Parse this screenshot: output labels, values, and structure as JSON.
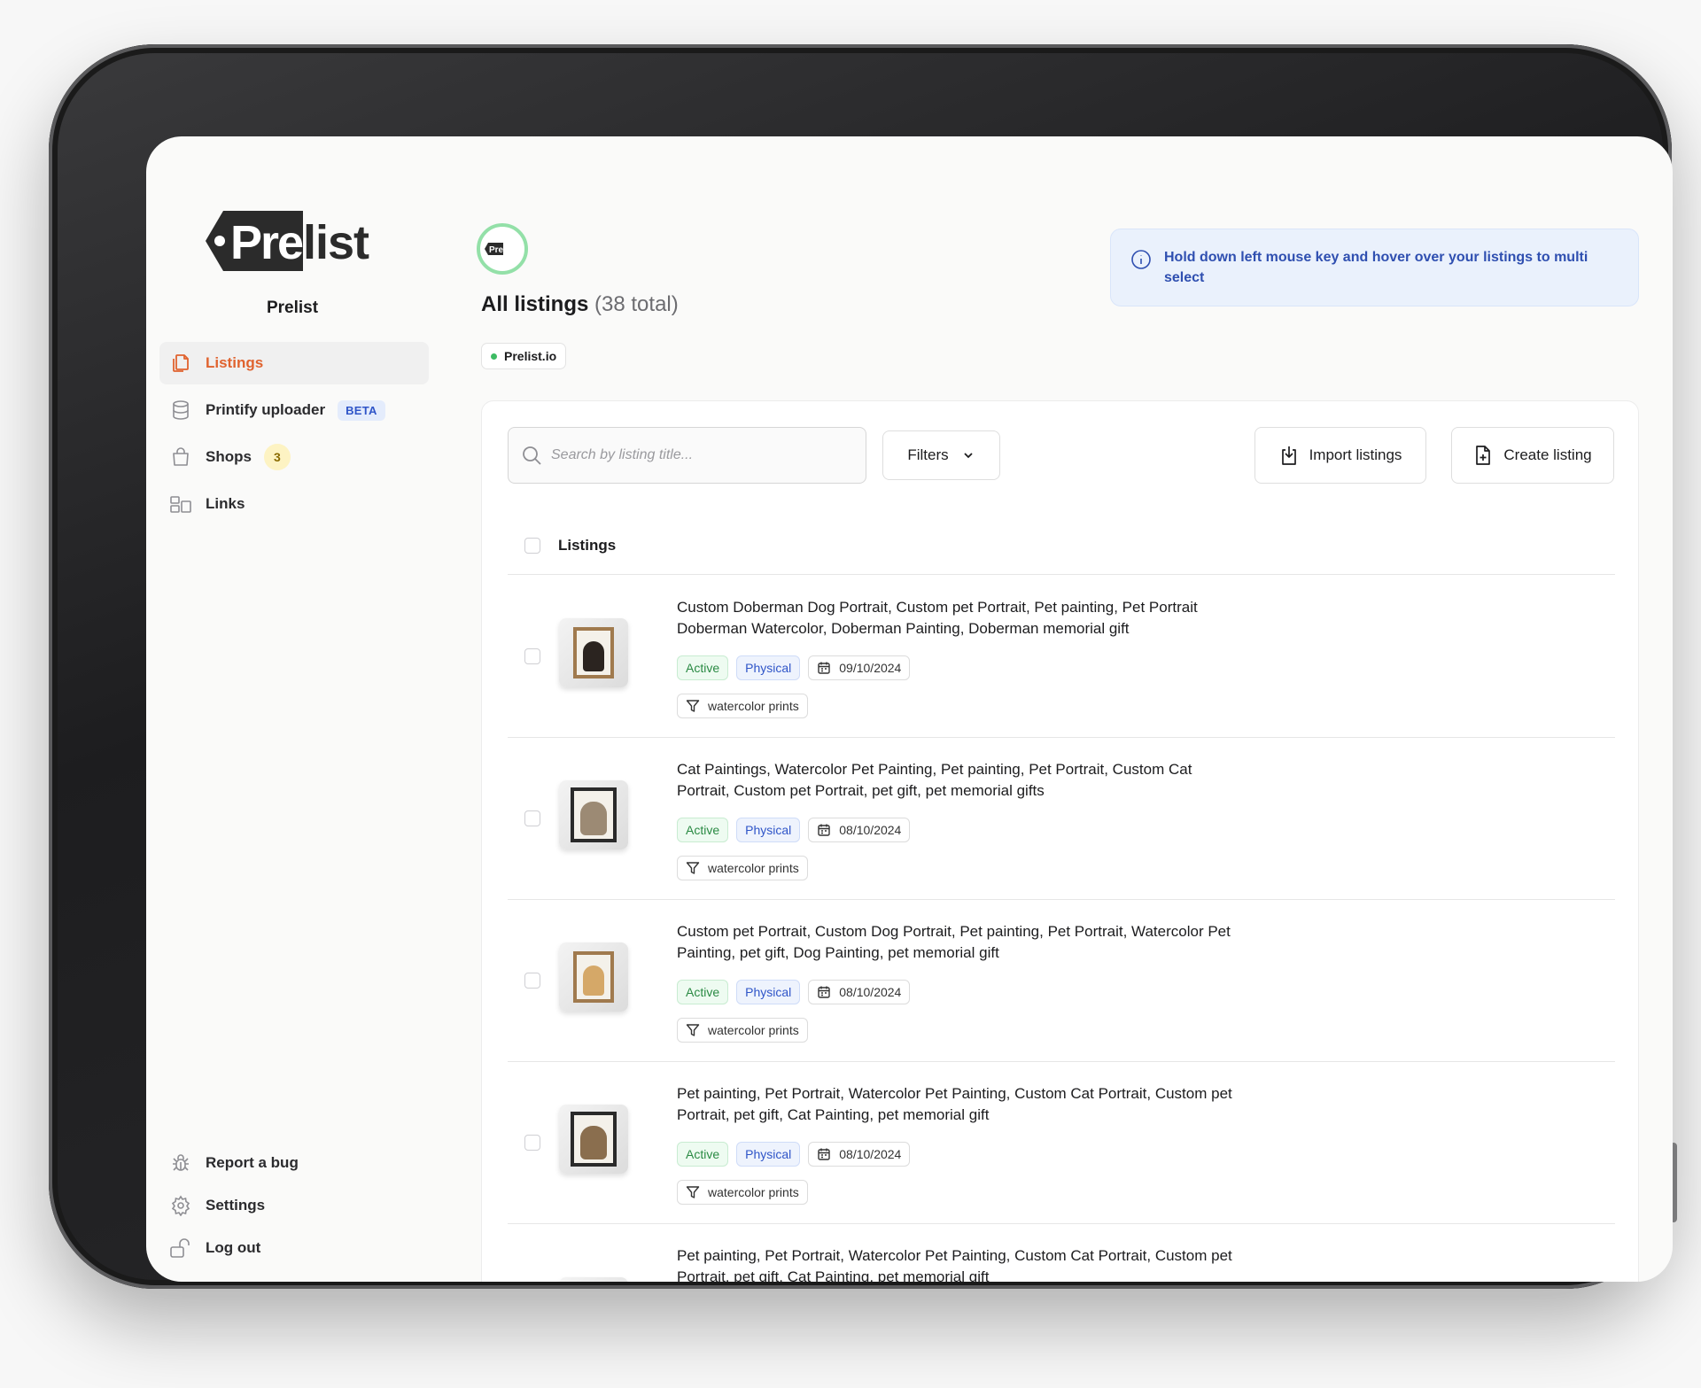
{
  "app": {
    "brand_name": "Prelist",
    "logo_text": "Prelist"
  },
  "sidebar": {
    "items": [
      {
        "label": "Listings",
        "icon": "copy-icon",
        "active": true
      },
      {
        "label": "Printify uploader",
        "icon": "database-icon",
        "badge": "BETA"
      },
      {
        "label": "Shops",
        "icon": "shopping-bag-icon",
        "count": "3"
      },
      {
        "label": "Links",
        "icon": "layout-icon"
      }
    ],
    "bottom_items": [
      {
        "label": "Report a bug",
        "icon": "bug-icon"
      },
      {
        "label": "Settings",
        "icon": "gear-icon"
      },
      {
        "label": "Log out",
        "icon": "unlock-icon"
      }
    ]
  },
  "header": {
    "avatar_text": "Prelist",
    "title": "All listings",
    "total": "(38 total)",
    "shop_chip": "Prelist.io",
    "info_message": "Hold down left mouse key and hover over your listings to multi select"
  },
  "toolbar": {
    "search_placeholder": "Search by listing title...",
    "filters_label": "Filters",
    "import_label": "Import listings",
    "create_label": "Create listing"
  },
  "list": {
    "header_label": "Listings",
    "rows": [
      {
        "title": "Custom Doberman Dog Portrait, Custom pet Portrait, Pet painting, Pet Portrait Doberman Watercolor, Doberman Painting, Doberman memorial gift",
        "status": "Active",
        "type": "Physical",
        "date": "09/10/2024",
        "collection": "watercolor prints"
      },
      {
        "title": "Cat Paintings, Watercolor Pet Painting, Pet painting, Pet Portrait, Custom Cat Portrait, Custom pet Portrait, pet gift, pet memorial gifts",
        "status": "Active",
        "type": "Physical",
        "date": "08/10/2024",
        "collection": "watercolor prints"
      },
      {
        "title": "Custom pet Portrait, Custom Dog Portrait, Pet painting, Pet Portrait, Watercolor Pet Painting, pet gift, Dog Painting, pet memorial gift",
        "status": "Active",
        "type": "Physical",
        "date": "08/10/2024",
        "collection": "watercolor prints"
      },
      {
        "title": "Pet painting, Pet Portrait, Watercolor Pet Painting, Custom Cat Portrait, Custom pet Portrait, pet gift, Cat Painting, pet memorial gift",
        "status": "Active",
        "type": "Physical",
        "date": "08/10/2024",
        "collection": "watercolor prints"
      },
      {
        "title": "Pet painting, Pet Portrait, Watercolor Pet Painting, Custom Cat Portrait, Custom pet Portrait, pet gift, Cat Painting, pet memorial gift"
      }
    ]
  },
  "colors": {
    "accent": "#e0632f",
    "active_green": "#2a8a43",
    "physical_blue": "#2f55c8",
    "info_blue": "#2f4fb0"
  }
}
